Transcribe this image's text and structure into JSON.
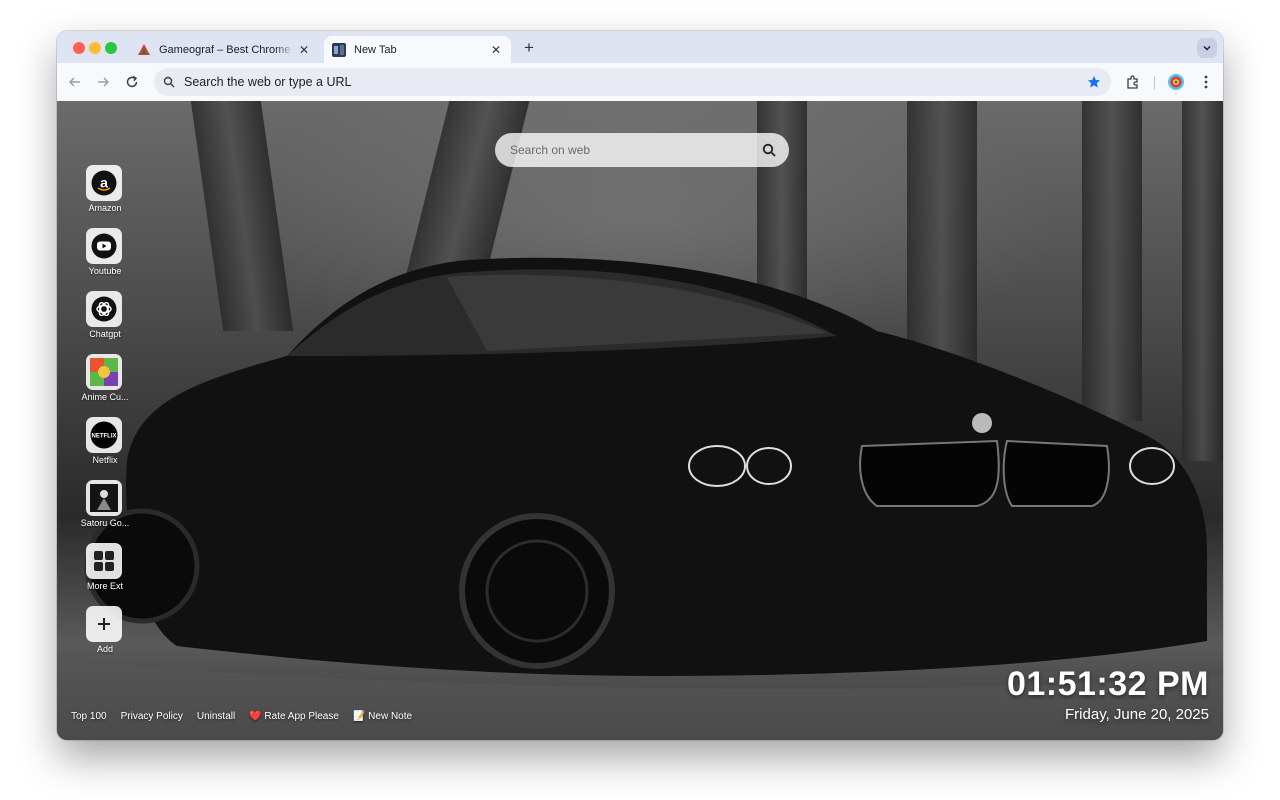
{
  "browser": {
    "tabs": [
      {
        "title": "Gameograf – Best Chrome Li",
        "favicon": "gameograf-icon",
        "active": false
      },
      {
        "title": "New Tab",
        "favicon": "newtab-icon",
        "active": true
      }
    ],
    "new_tab_glyph": "+",
    "address_bar": {
      "placeholder": "Search the web or type a URL"
    }
  },
  "page": {
    "search": {
      "placeholder": "Search on web"
    },
    "shortcuts": [
      {
        "label": "Amazon",
        "icon": "amazon-icon"
      },
      {
        "label": "Youtube",
        "icon": "youtube-icon"
      },
      {
        "label": "Chatgpt",
        "icon": "chatgpt-icon"
      },
      {
        "label": "Anime Cu...",
        "icon": "anime-icon"
      },
      {
        "label": "Netflix",
        "icon": "netflix-icon"
      },
      {
        "label": "Satoru Go...",
        "icon": "satoru-icon"
      },
      {
        "label": "More Ext",
        "icon": "more-ext-icon"
      },
      {
        "label": "Add",
        "icon": "plus-icon"
      }
    ],
    "footer": {
      "top100": "Top 100",
      "privacy": "Privacy Policy",
      "uninstall": "Uninstall",
      "rate": "❤️ Rate App Please",
      "note": "📝 New Note"
    },
    "clock": {
      "time": "01:51:32 PM",
      "date": "Friday, June 20, 2025"
    }
  },
  "colors": {
    "accent": "#1a73e8",
    "netflix": "#e50914",
    "tab_bar": "#dfe4f2"
  }
}
